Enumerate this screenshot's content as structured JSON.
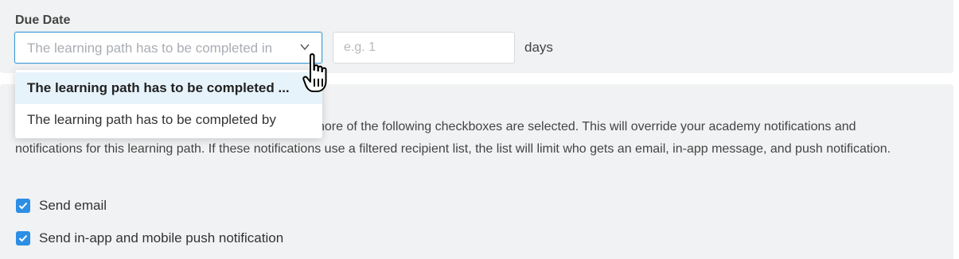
{
  "due_date": {
    "label": "Due Date",
    "select_placeholder": "The learning path has to be completed in",
    "days_placeholder": "e.g. 1",
    "days_unit": "days",
    "options": [
      "The learning path has to be completed ...",
      "The learning path has to be completed by"
    ]
  },
  "notifications": {
    "description_visible_start": "nore of the following checkboxes are selected. This will override your academy notifications and",
    "description_rest": "notifications for this learning path. If these notifications use a filtered recipient list, the list will limit who gets an email, in-app message, and push notification.",
    "checkboxes": [
      {
        "label": "Send email",
        "checked": true
      },
      {
        "label": "Send in-app and mobile push notification",
        "checked": true
      }
    ]
  },
  "colors": {
    "accent": "#2d8ee5",
    "panel": "#f1f2f3",
    "focus_border": "#3b9ad9"
  }
}
